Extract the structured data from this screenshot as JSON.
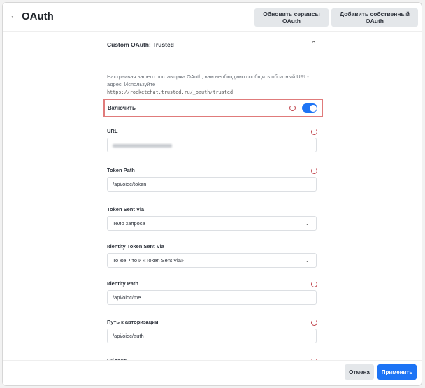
{
  "header": {
    "back_icon": "arrow-left-icon",
    "title": "OAuth",
    "refresh_button": "Обновить сервисы OAuth",
    "add_button": "Добавить собственный OAuth"
  },
  "section": {
    "title": "Custom OAuth: Trusted",
    "collapse_icon": "chevron-up-icon",
    "description": "Настраивая вашего поставщика OAuth, вам необходимо сообщить обратный URL-адрес. Используйте",
    "callback_url": "https://rocketchat.trusted.ru/_oauth/trusted"
  },
  "enable": {
    "label": "Включить",
    "enabled": true,
    "accent": "#1d74f5"
  },
  "fields": [
    {
      "label": "URL",
      "value": "",
      "blurred": true,
      "reset": true
    },
    {
      "label": "Token Path",
      "value": "/api/oidc/token",
      "reset": true
    },
    {
      "label": "Token Sent Via",
      "value": "Тело запроса",
      "select": true
    },
    {
      "label": "Identity Token Sent Via",
      "value": "То же, что и «Token Sent Via»",
      "select": true
    },
    {
      "label": "Identity Path",
      "value": "/api/oidc/me",
      "reset": true
    },
    {
      "label": "Путь к авторизации",
      "value": "/api/oidc/auth",
      "reset": true
    },
    {
      "label": "Область",
      "reset": true
    }
  ],
  "footer": {
    "cancel": "Отмена",
    "apply": "Применить"
  }
}
